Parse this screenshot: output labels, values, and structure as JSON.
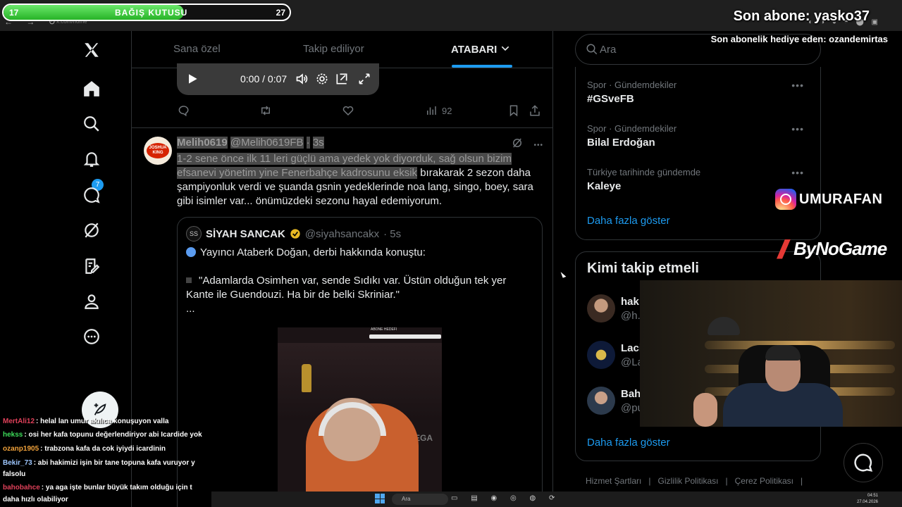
{
  "browser": {
    "nav_glyphs": "← → ↻",
    "url": "x.com/home",
    "extension_glyphs": "◐ ◑ ◒ ◓ ⬤ ▣"
  },
  "nav": {
    "items": [
      {
        "icon": "x-logo-icon",
        "label": "X"
      },
      {
        "icon": "home-icon",
        "label": "Home"
      },
      {
        "icon": "search-icon",
        "label": "Explore"
      },
      {
        "icon": "bell-icon",
        "label": "Notifications",
        "badge": "7"
      },
      {
        "icon": "chat-icon",
        "label": "Messages"
      },
      {
        "icon": "grok-icon",
        "label": "Grok"
      },
      {
        "icon": "lists-icon",
        "label": "Lists"
      },
      {
        "icon": "person-icon",
        "label": "Profile"
      },
      {
        "icon": "more-icon",
        "label": "More"
      }
    ],
    "compose_icon": "feather-plus-icon"
  },
  "timeline": {
    "tabs": [
      {
        "label": "Sana özel",
        "active": false
      },
      {
        "label": "Takip ediliyor",
        "active": false
      },
      {
        "label": "ATABARI",
        "active": true
      }
    ],
    "video": {
      "time": "0:00 / 0:07"
    },
    "tweet1_actions": {
      "views": "92"
    },
    "tweet2": {
      "name": "Melih0619",
      "handle": "@Melih0619FB",
      "dot": "·",
      "time": "3s",
      "body_highlight_1": "1-2 sene önce ilk 11 leri güçlü ama yedek yok diyorduk, sağ olsun bizim",
      "body_highlight_2": "efsanevi yönetim yine Fenerbahçe kadrosunu eksik",
      "body_rest_1": " bırakarak 2 sezon daha",
      "body_rest_2": "şampiyonluk verdi ve şuanda gsnin yedeklerinde noa lang, singo, boey, sara",
      "body_rest_3": "gibi isimler var... önümüzdeki sezonu hayal edemiyorum.",
      "avatar_text_1": "JOSHUA",
      "avatar_text_2": "KING",
      "quote": {
        "avatar_text": "SS",
        "name": "SİYAH SANCAK",
        "handle": "@siyahsancakx",
        "time": "· 5s",
        "line1": "Yayıncı Ataberk Doğan, derbi hakkında konuştu:",
        "line2": "\"Adamlarda Osimhen var, sende Sıdıkı var. Üstün olduğun tek yer Kante ile Guendouzi. Ha bir de belki Skriniar.\"",
        "line3": "...",
        "media_label": "ABONE HEDEFİ",
        "media_wall": "EXVEGA"
      }
    }
  },
  "right": {
    "search_placeholder": "Ara",
    "trends": [
      {
        "context": "Spor · Gündemdekiler",
        "name": "#GSveFB"
      },
      {
        "context": "Spor · Gündemdekiler",
        "name": "Bilal Erdoğan"
      },
      {
        "context": "Türkiye tarihinde gündemde",
        "name": "Kaleye"
      }
    ],
    "trends_more": "Daha fazla göster",
    "who_title": "Kimi takip etmeli",
    "who": [
      {
        "name": "hak",
        "handle": "@h.."
      },
      {
        "name": "Laci",
        "handle": "@La"
      },
      {
        "name": "Bah",
        "handle": "@pu"
      }
    ],
    "who_more": "Daha fazla göster",
    "footer": [
      "Hizmet Şartları",
      "|",
      "Gizlilik Politikası",
      "|",
      "Çerez Politikası",
      "|"
    ],
    "more_glyph": "•••"
  },
  "overlay": {
    "donation": {
      "current": "17",
      "label": "BAĞIŞ KUTUSU",
      "goal": "27",
      "progress": 0.63
    },
    "last_sub": "Son abone: yasko37",
    "last_gift": "Son abonelik hediye eden: ozandemirtas",
    "instagram": "UMURAFAN",
    "sponsor": "ByNoGame"
  },
  "chat": [
    {
      "user": "MertAli12",
      "color": "#e0415a",
      "text": ": helal lan umur akılıca konuşuyon valla"
    },
    {
      "user": "hekss",
      "color": "#3ddc5a",
      "text": ": osi her kafa topunu değerlendiriyor abi Icardide yok"
    },
    {
      "user": "ozanp1905",
      "color": "#f0a23b",
      "text": ": trabzona kafa da cok iyiydi icardinin"
    },
    {
      "user": "Bekir_73",
      "color": "#9ec7ff",
      "text": ": abi hakimizi işin bir tane topuna kafa vuruyor y"
    },
    {
      "user": "",
      "color": "#fff",
      "text": "falsolu"
    },
    {
      "user": "bahobahce",
      "color": "#e0415a",
      "text": ": ya aga işte bunlar büyük takım olduğu için t"
    },
    {
      "user": "",
      "color": "#fff",
      "text": "daha hızlı olabiliyor"
    }
  ],
  "taskbar": {
    "search": "Ara",
    "app_glyphs": "▭ ▤ ◉ ◎ ◍ ⟳",
    "time": "04:51",
    "date": "27.04.2026"
  }
}
